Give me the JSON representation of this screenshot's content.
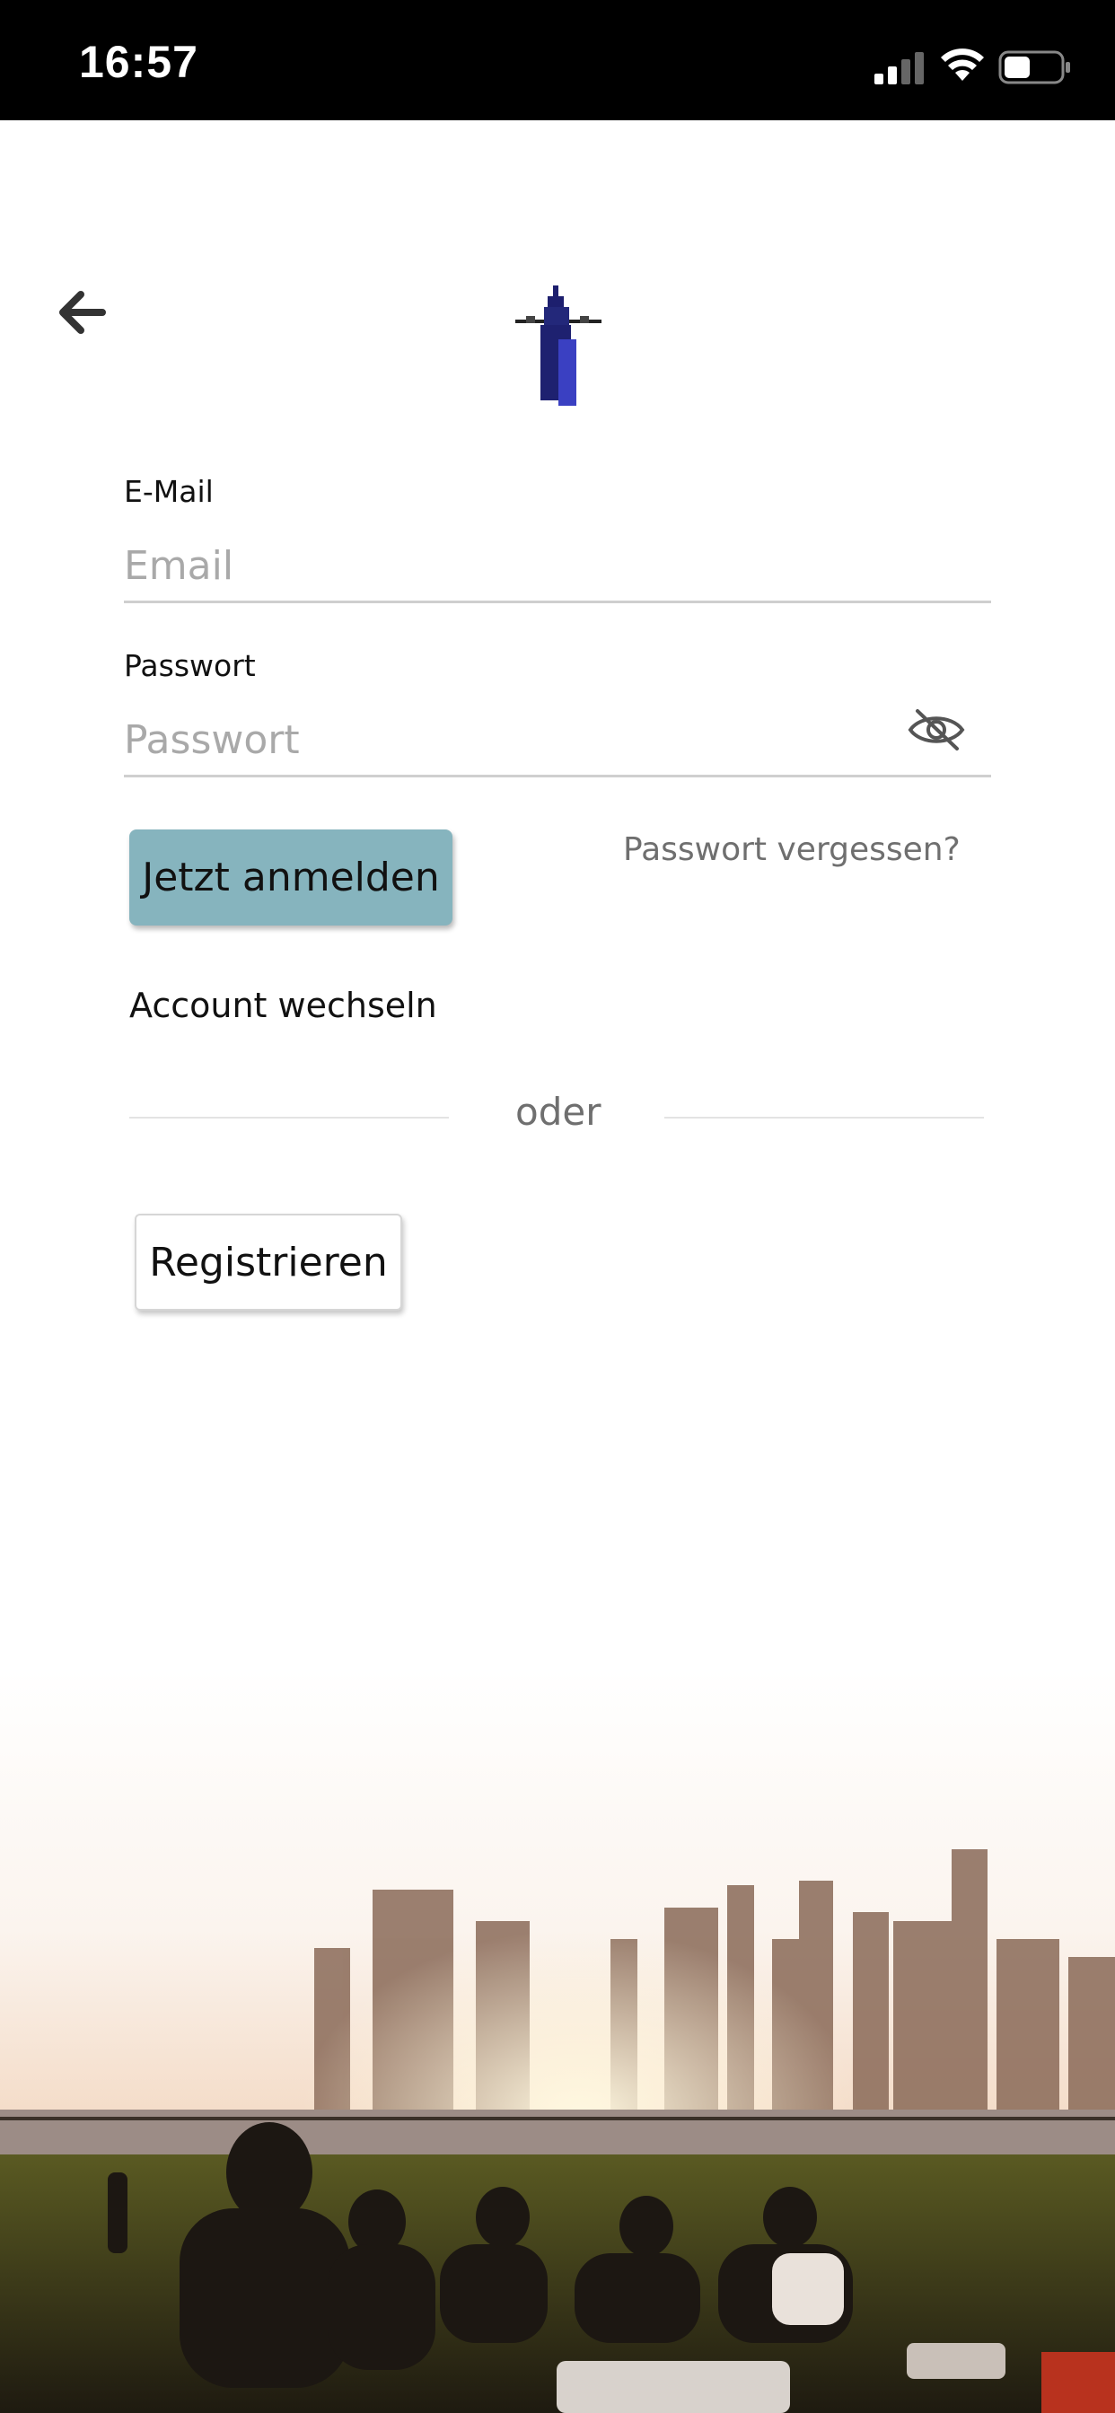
{
  "status_bar": {
    "time": "16:57",
    "icons": [
      "cellular-signal-icon",
      "wifi-icon",
      "battery-icon"
    ]
  },
  "header": {
    "back_icon": "arrow-left-icon",
    "logo": "tower-logo"
  },
  "form": {
    "email": {
      "label": "E-Mail",
      "placeholder": "Email",
      "value": ""
    },
    "password": {
      "label": "Passwort",
      "placeholder": "Passwort",
      "value": "",
      "toggle_icon": "eye-slash-icon"
    },
    "login_button": "Jetzt anmelden",
    "forgot_password": "Passwort vergessen?",
    "switch_account": "Account wechseln",
    "divider": "oder",
    "register_button": "Registrieren"
  },
  "colors": {
    "status_bar_bg": "#000000",
    "primary_button": "#86b4be",
    "muted_text": "#6f6f6f",
    "placeholder": "#a9a9a9",
    "logo_blue": "#2b2f9e"
  }
}
